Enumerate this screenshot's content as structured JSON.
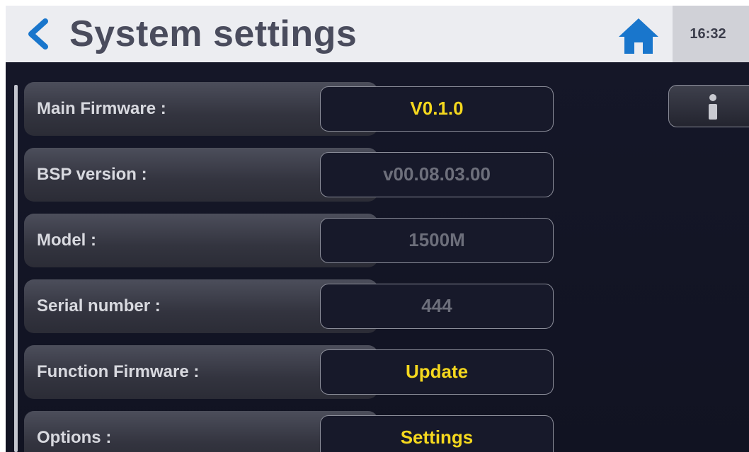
{
  "header": {
    "title": "System settings",
    "time": "16:32",
    "back_icon": "chevron-left-icon",
    "home_icon": "home-icon"
  },
  "info_button": {
    "icon": "info-icon"
  },
  "rows": [
    {
      "label": "Main Firmware :",
      "value": "V0.1.0",
      "style": "active"
    },
    {
      "label": "BSP version :",
      "value": "v00.08.03.00",
      "style": "readonly"
    },
    {
      "label": "Model :",
      "value": "1500M",
      "style": "readonly"
    },
    {
      "label": "Serial number :",
      "value": "444",
      "style": "readonly"
    },
    {
      "label": "Function Firmware :",
      "value": "Update",
      "style": "active"
    },
    {
      "label": "Options :",
      "value": "Settings",
      "style": "active"
    }
  ],
  "colors": {
    "accent_back": "#1976cc",
    "value_active": "#f5d81e",
    "value_readonly": "#6d6f7b",
    "header_bg": "#ecedf1",
    "screen_bg": "#141626"
  }
}
